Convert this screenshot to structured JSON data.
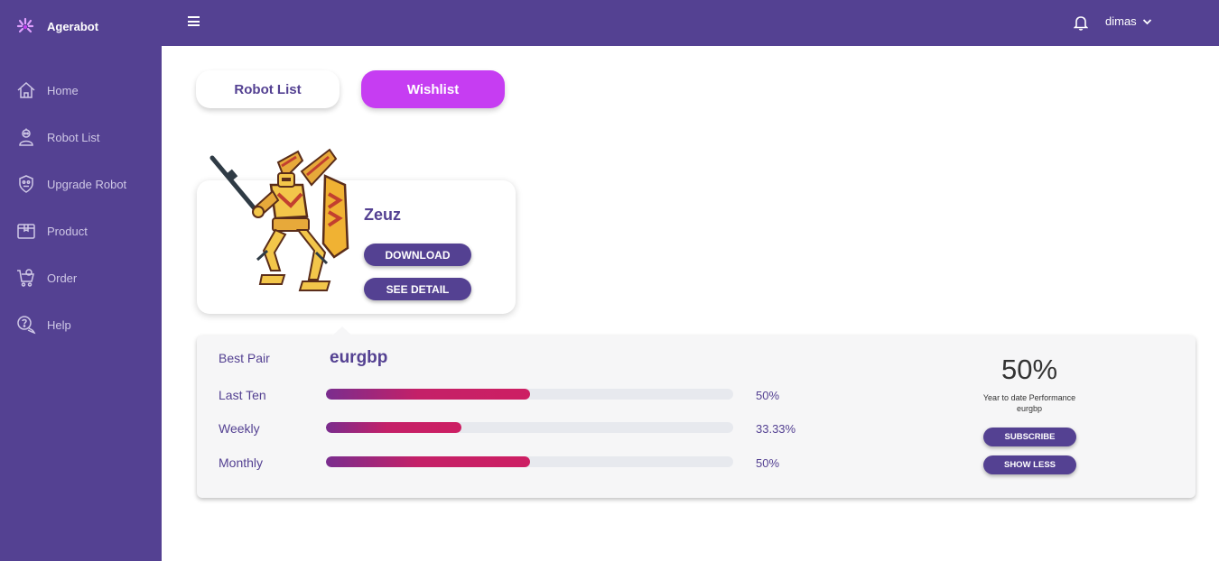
{
  "app": {
    "name": "Agerabot"
  },
  "sidebar": {
    "items": [
      {
        "label": "Home",
        "icon": "home-icon"
      },
      {
        "label": "Robot List",
        "icon": "robot-icon"
      },
      {
        "label": "Upgrade Robot",
        "icon": "upgrade-robot-icon"
      },
      {
        "label": "Product",
        "icon": "product-box-icon"
      },
      {
        "label": "Order",
        "icon": "cart-icon"
      },
      {
        "label": "Help",
        "icon": "help-chat-icon"
      }
    ]
  },
  "header": {
    "user_name": "dimas"
  },
  "tabs": [
    {
      "label": "Robot List",
      "active": false
    },
    {
      "label": "Wishlist",
      "active": true
    }
  ],
  "robot": {
    "name": "Zeuz",
    "download_label": "DOWNLOAD",
    "detail_label": "SEE DETAIL"
  },
  "stats": {
    "best_pair_label": "Best Pair",
    "best_pair_value": "eurgbp",
    "rows": [
      {
        "label": "Last Ten",
        "percent": 50,
        "percent_text": "50%"
      },
      {
        "label": "Weekly",
        "percent": 33.33,
        "percent_text": "33.33%"
      },
      {
        "label": "Monthly",
        "percent": 50,
        "percent_text": "50%"
      }
    ],
    "ytd_percent": "50%",
    "ytd_caption": "Year to date Performance",
    "ytd_pair": "eurgbp",
    "subscribe_label": "SUBSCRIBE",
    "show_less_label": "SHOW LESS"
  },
  "colors": {
    "primary": "#544192",
    "accent": "#c63df2",
    "progress_end": "#cd1f63",
    "progress_start": "#7a2d8e"
  }
}
